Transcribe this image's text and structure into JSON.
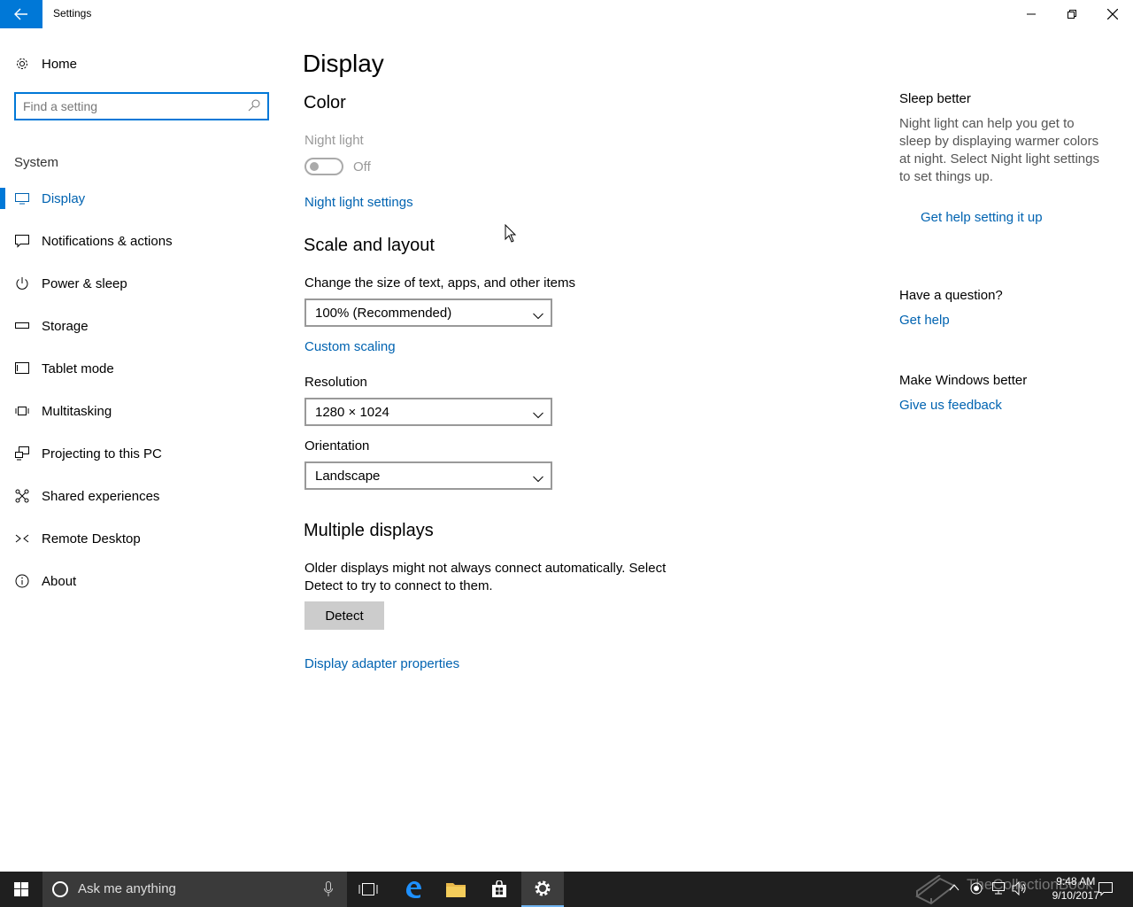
{
  "window": {
    "title": "Settings"
  },
  "sidebar": {
    "home_label": "Home",
    "search_placeholder": "Find a setting",
    "section_label": "System",
    "items": [
      {
        "label": "Display",
        "icon": "monitor-icon"
      },
      {
        "label": "Notifications & actions",
        "icon": "notifications-icon"
      },
      {
        "label": "Power & sleep",
        "icon": "power-icon"
      },
      {
        "label": "Storage",
        "icon": "storage-icon"
      },
      {
        "label": "Tablet mode",
        "icon": "tablet-icon"
      },
      {
        "label": "Multitasking",
        "icon": "multitasking-icon"
      },
      {
        "label": "Projecting to this PC",
        "icon": "projecting-icon"
      },
      {
        "label": "Shared experiences",
        "icon": "shared-icon"
      },
      {
        "label": "Remote Desktop",
        "icon": "remote-desktop-icon"
      },
      {
        "label": "About",
        "icon": "info-icon"
      }
    ]
  },
  "main": {
    "title": "Display",
    "color_heading": "Color",
    "night_light_label": "Night light",
    "night_light_state": "Off",
    "night_light_settings_link": "Night light settings",
    "scale_heading": "Scale and layout",
    "scale_label": "Change the size of text, apps, and other items",
    "scale_value": "100% (Recommended)",
    "custom_scaling_link": "Custom scaling",
    "resolution_label": "Resolution",
    "resolution_value": "1280 × 1024",
    "orientation_label": "Orientation",
    "orientation_value": "Landscape",
    "multiple_heading": "Multiple displays",
    "multiple_text_1": "Older displays might not always connect automatically. Select",
    "multiple_text_2": "Detect to try to connect to them.",
    "detect_button": "Detect",
    "adapter_link": "Display adapter properties"
  },
  "aside": {
    "sleep_heading": "Sleep better",
    "sleep_text_1": "Night light can help you get to",
    "sleep_text_2": "sleep by displaying warmer colors",
    "sleep_text_3": "at night. Select Night light settings",
    "sleep_text_4": "to set things up.",
    "sleep_link": "Get help setting it up",
    "question_heading": "Have a question?",
    "question_link": "Get help",
    "better_heading": "Make Windows better",
    "better_link": "Give us feedback"
  },
  "taskbar": {
    "search_placeholder": "Ask me anything",
    "time": "9:48 AM",
    "date": "9/10/2017",
    "watermark": "TheCollectionBook"
  },
  "colors": {
    "accent": "#0078d7",
    "link": "#0063b1",
    "taskbar": "#1f1f1f"
  }
}
